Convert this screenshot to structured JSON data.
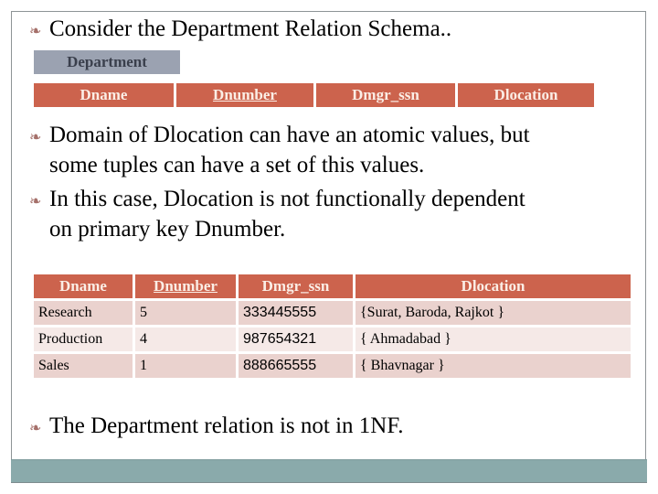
{
  "slide": {
    "bullets": [
      "Consider the Department Relation Schema..",
      "Domain of Dlocation can have an atomic values, but some tuples can have a set of this values.",
      "In this case, Dlocation is not functionally dependent on primary key Dnumber.",
      "The Department relation is not in 1NF."
    ],
    "bullet_lines": {
      "b2_line1": "Domain of Dlocation can have an atomic values, but",
      "b2_line2": "some tuples can have a set of this values.",
      "b3_line1": "In this case, Dlocation is not functionally dependent",
      "b3_line2": "on primary key Dnumber."
    },
    "bullet_icon": "scroll-bullet-icon",
    "bullet_glyph": "❧",
    "colors": {
      "header": "#cc634d",
      "relation_label": "#9ba2b1",
      "row_odd": "#ead2ce",
      "row_even": "#f5e9e7",
      "footer_bar": "#8aaaab"
    }
  },
  "schema": {
    "relation_name": "Department",
    "attributes": [
      "Dname",
      "Dnumber",
      "Dmgr_ssn",
      "Dlocation"
    ],
    "primary_key": "Dnumber"
  },
  "table": {
    "columns": [
      "Dname",
      "Dnumber",
      "Dmgr_ssn",
      "Dlocation"
    ],
    "rows": [
      [
        "Research",
        "5",
        "333445555",
        "{Surat, Baroda, Rajkot }"
      ],
      [
        "Production",
        "4",
        "987654321",
        "{ Ahmadabad }"
      ],
      [
        "Sales",
        "1",
        "888665555",
        "{ Bhavnagar }"
      ]
    ]
  }
}
